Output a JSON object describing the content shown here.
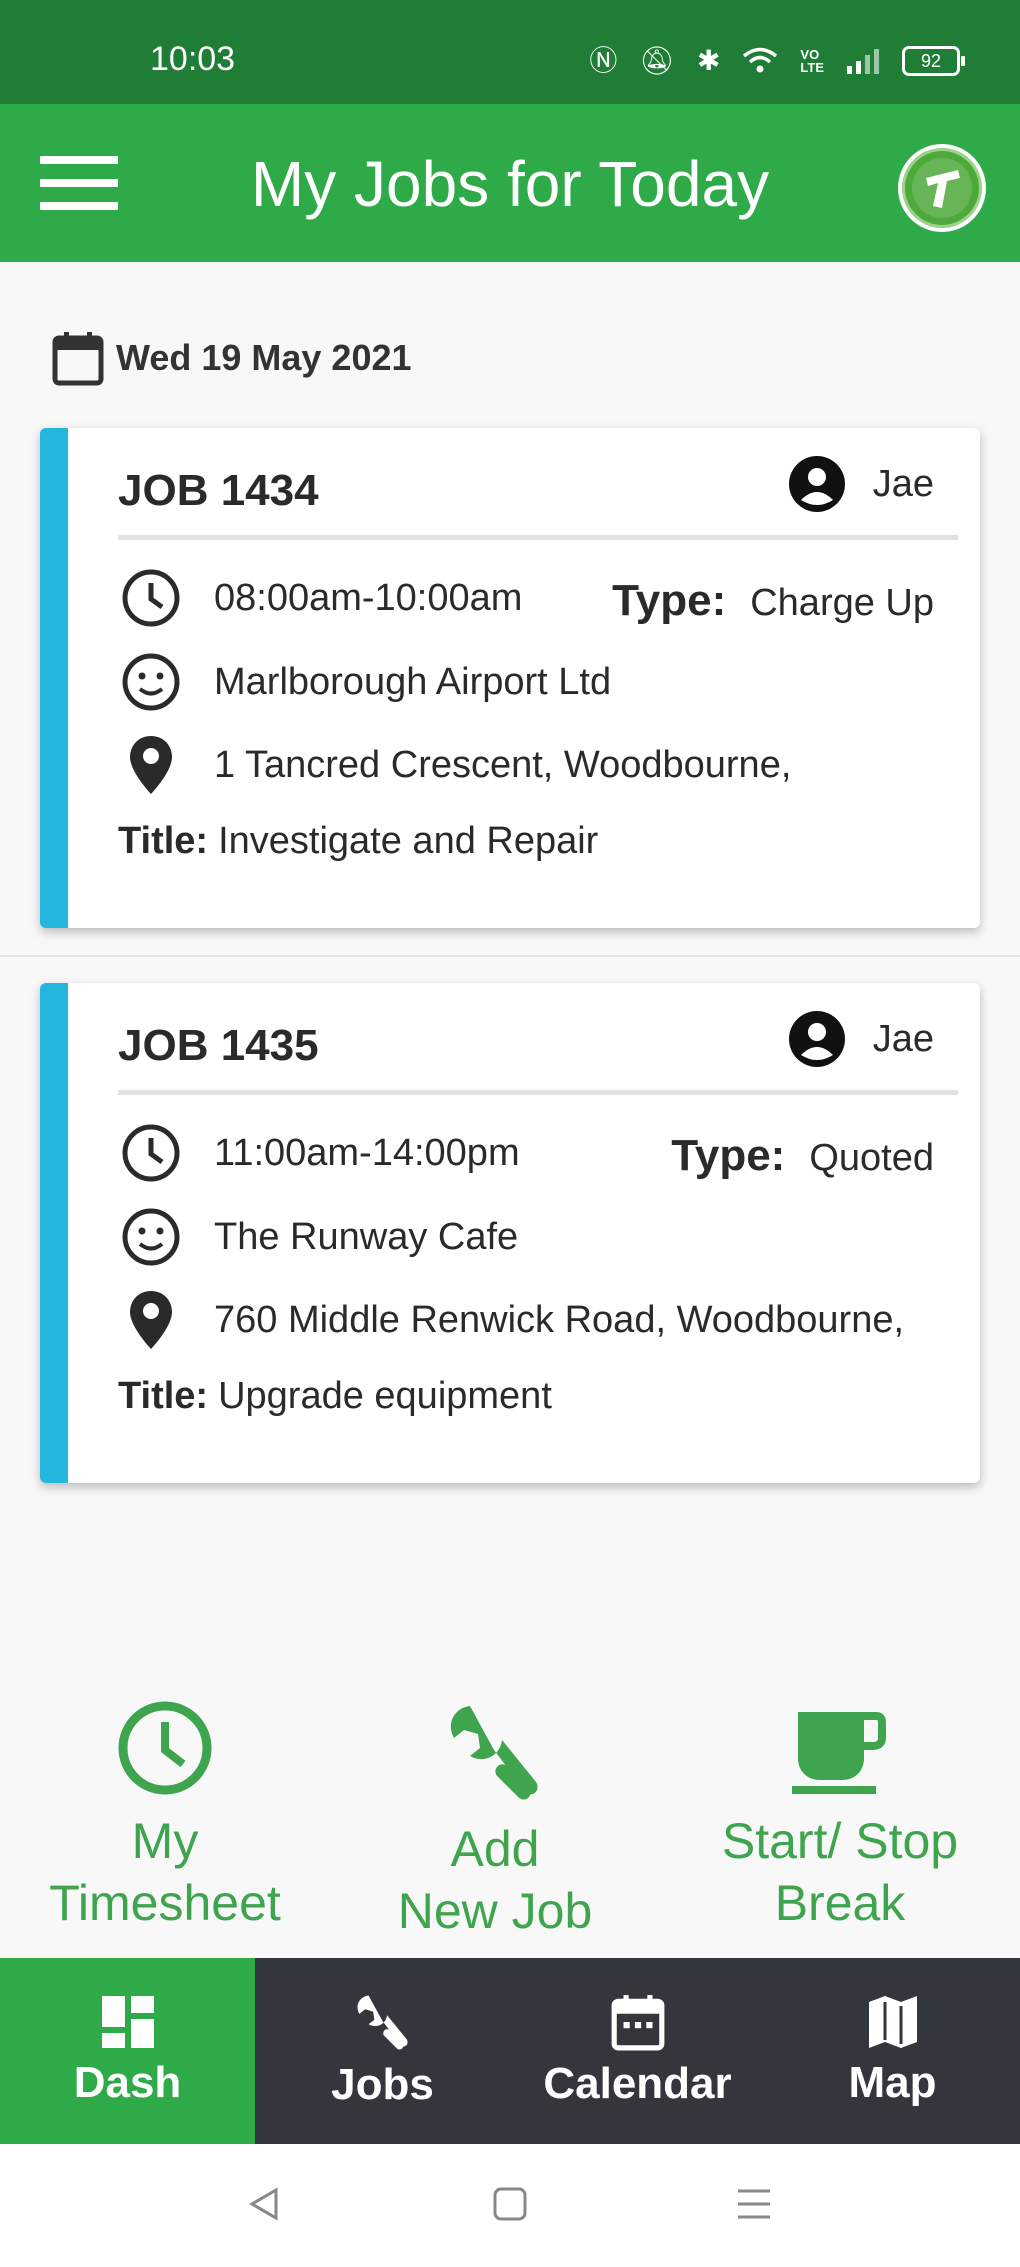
{
  "status_bar": {
    "time": "10:03",
    "battery": "92"
  },
  "header": {
    "title": "My Jobs for Today"
  },
  "date": "Wed 19 May 2021",
  "jobs": [
    {
      "number": "JOB 1434",
      "assignee": "Jae",
      "time": "08:00am-10:00am",
      "type_label": "Type:",
      "type": "Charge Up",
      "client": "Marlborough Airport Ltd",
      "address": "1 Tancred Crescent, Woodbourne,",
      "title_label": "Title:",
      "title": "Investigate and Repair"
    },
    {
      "number": "JOB 1435",
      "assignee": "Jae",
      "time": "11:00am-14:00pm",
      "type_label": "Type:",
      "type": "Quoted",
      "client": "The Runway Cafe",
      "address": "760 Middle Renwick Road, Woodbourne,",
      "title_label": "Title:",
      "title": "Upgrade equipment"
    }
  ],
  "actions": {
    "timesheet_1": "My",
    "timesheet_2": "Timesheet",
    "add_job_1": "Add",
    "add_job_2": "New Job",
    "break_1": "Start/ Stop",
    "break_2": "Break"
  },
  "tabs": [
    {
      "label": "Dash",
      "icon": "dashboard-icon"
    },
    {
      "label": "Jobs",
      "icon": "wrench-icon"
    },
    {
      "label": "Calendar",
      "icon": "calendar-icon"
    },
    {
      "label": "Map",
      "icon": "map-icon"
    }
  ],
  "colors": {
    "status_bar": "#1f7d36",
    "primary": "#2eab48",
    "card_accent": "#24b6dc",
    "tab_bar": "#34363d",
    "action_green": "#3fa44e"
  }
}
